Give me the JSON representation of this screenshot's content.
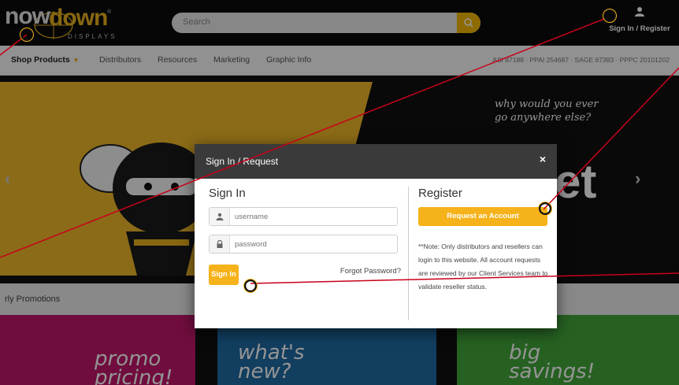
{
  "header": {
    "logo": {
      "part1": "now",
      "part2": "down",
      "sub": "DISPLAYS",
      "reg": "®"
    },
    "search": {
      "placeholder": "Search"
    },
    "account_link": "Sign In / Register"
  },
  "nav": {
    "items": [
      {
        "label": "Shop Products"
      },
      {
        "label": "Distributors"
      },
      {
        "label": "Resources"
      },
      {
        "label": "Marketing"
      },
      {
        "label": "Graphic Info"
      }
    ],
    "codes": "ASI 87188 · PPAI 254687 · SAGE 67383 · PPPC 20101202"
  },
  "hero": {
    "tagline_1": "why would you ever",
    "tagline_2": "go anywhere else?",
    "partial_word": "et",
    "prev": "‹",
    "next": "›"
  },
  "promotions": {
    "heading": "rly Promotions",
    "tiles": [
      {
        "l1": "promo",
        "l2": "pricing!"
      },
      {
        "l1": "what's",
        "l2": "new?"
      },
      {
        "l1": "big",
        "l2": "savings!"
      }
    ]
  },
  "modal": {
    "title": "Sign In / Request",
    "close": "×",
    "signin": {
      "heading": "Sign In",
      "username_placeholder": "username",
      "password_placeholder": "password",
      "button": "Sign In",
      "forgot": "Forgot Password?"
    },
    "register": {
      "heading": "Register",
      "button": "Request an Account",
      "note": "**Note: Only distributors and resellers can login to this website. All account requests are reviewed by our Client Services team to validate reseller status."
    }
  },
  "colors": {
    "accent": "#f5b21a",
    "callout": "#c8001a",
    "modal_header": "#3a3a3a"
  }
}
